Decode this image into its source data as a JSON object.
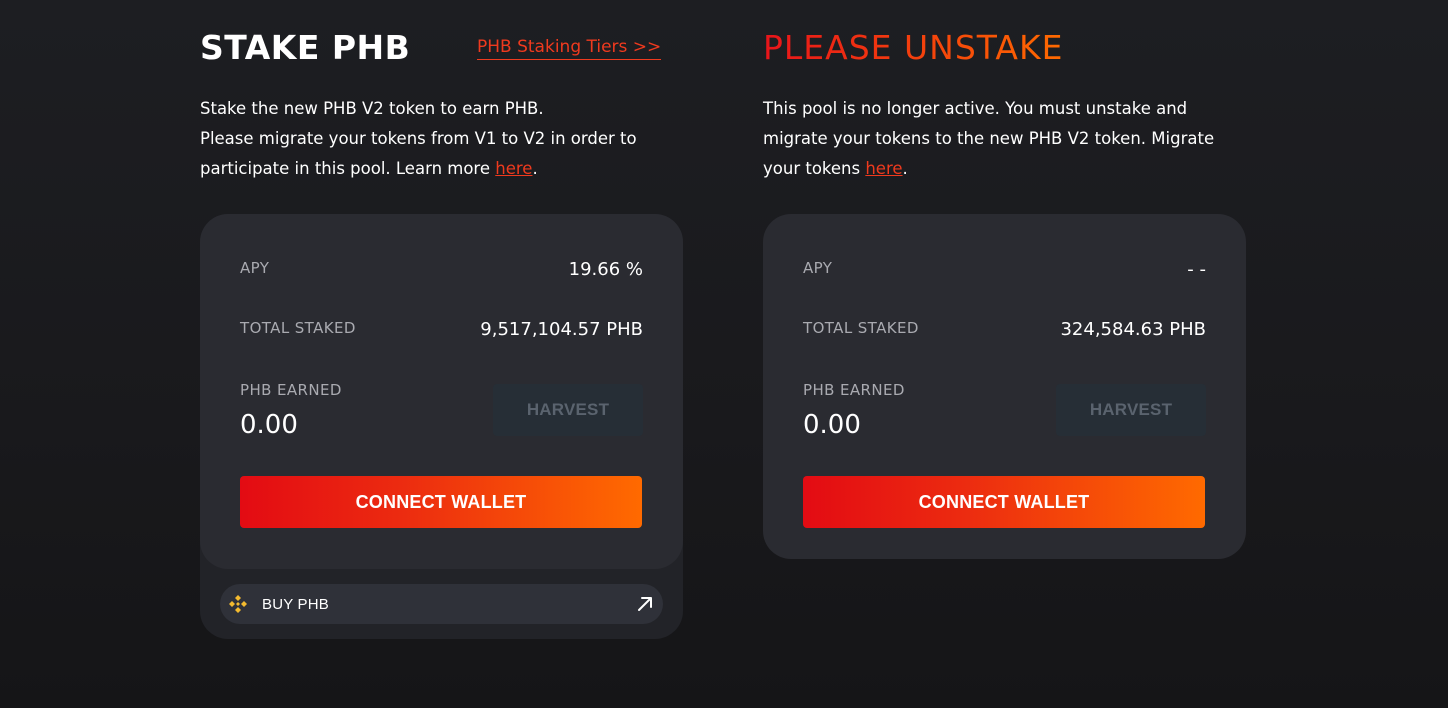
{
  "left_pool": {
    "title": "STAKE PHB",
    "tiers_link": "PHB Staking Tiers >>",
    "description_line1": "Stake the new PHB V2 token to earn PHB.",
    "description_line2": "Please migrate your tokens from V1 to V2 in order to participate in this pool. Learn more",
    "description_link": "here",
    "description_end": ".",
    "apy_label": "APY",
    "apy_value": "19.66 %",
    "total_staked_label": "TOTAL STAKED",
    "total_staked_value": "9,517,104.57 PHB",
    "earned_label": "PHB EARNED",
    "earned_value": "0.00",
    "harvest_label": "HARVEST",
    "connect_label": "CONNECT WALLET",
    "buy_label": "BUY PHB",
    "buy_icon": "binance-icon",
    "external_icon": "arrow-up-right-icon"
  },
  "right_pool": {
    "title": "PLEASE UNSTAKE",
    "description_text": "This pool is no longer active. You must unstake and migrate your tokens to the new PHB V2 token. Migrate your tokens",
    "description_link": "here",
    "description_end": ".",
    "apy_label": "APY",
    "apy_value": "- -",
    "total_staked_label": "TOTAL STAKED",
    "total_staked_value": "324,584.63 PHB",
    "earned_label": "PHB EARNED",
    "earned_value": "0.00",
    "harvest_label": "HARVEST",
    "connect_label": "CONNECT WALLET"
  },
  "colors": {
    "accent_red": "#e8141a",
    "accent_orange": "#ff6a00",
    "link": "#ef3a1e",
    "card_bg": "#2a2b31",
    "binance_yellow": "#f3ba2f"
  }
}
